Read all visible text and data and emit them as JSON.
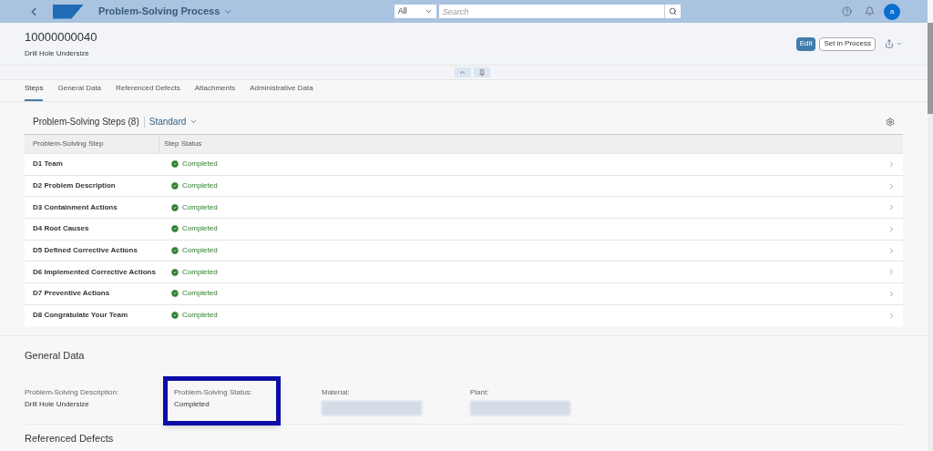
{
  "shell": {
    "title": "Problem-Solving Process",
    "search_scope": "All",
    "search_placeholder": "Search",
    "avatar": "a"
  },
  "header": {
    "id": "10000000040",
    "subtitle": "Drill Hole Undersize",
    "actions": [
      {
        "label": "Edit",
        "kind": "emphasized"
      },
      {
        "label": "Set in Process",
        "kind": "default"
      }
    ]
  },
  "tabs": [
    {
      "label": "Steps",
      "selected": true
    },
    {
      "label": "General Data",
      "selected": false
    },
    {
      "label": "Referenced Defects",
      "selected": false
    },
    {
      "label": "Attachments",
      "selected": false
    },
    {
      "label": "Administrative Data",
      "selected": false
    }
  ],
  "steps_table": {
    "title": "Problem-Solving Steps (8)",
    "variant": "Standard",
    "columns": [
      "Problem-Solving Step",
      "Step Status"
    ],
    "rows": [
      {
        "step": "D1 Team",
        "status": "Completed"
      },
      {
        "step": "D2 Problem Description",
        "status": "Completed"
      },
      {
        "step": "D3 Containment Actions",
        "status": "Completed"
      },
      {
        "step": "D4 Root Causes",
        "status": "Completed"
      },
      {
        "step": "D5 Defined Corrective Actions",
        "status": "Completed"
      },
      {
        "step": "D6 Implemented Corrective Actions",
        "status": "Completed"
      },
      {
        "step": "D7 Preventive Actions",
        "status": "Completed"
      },
      {
        "step": "D8 Congratulate Your Team",
        "status": "Completed"
      }
    ]
  },
  "general_data": {
    "title": "General Data",
    "fields": [
      {
        "label": "Problem-Solving Description:",
        "value": "Drill Hole Undersize",
        "highlighted": false,
        "redacted": false
      },
      {
        "label": "Problem-Solving Status:",
        "value": "Completed",
        "highlighted": true,
        "redacted": false
      },
      {
        "label": "Material:",
        "highlighted": false,
        "redacted": true
      },
      {
        "label": "Plant:",
        "highlighted": false,
        "redacted": true
      }
    ]
  },
  "next_section": {
    "title": "Referenced Defects"
  }
}
